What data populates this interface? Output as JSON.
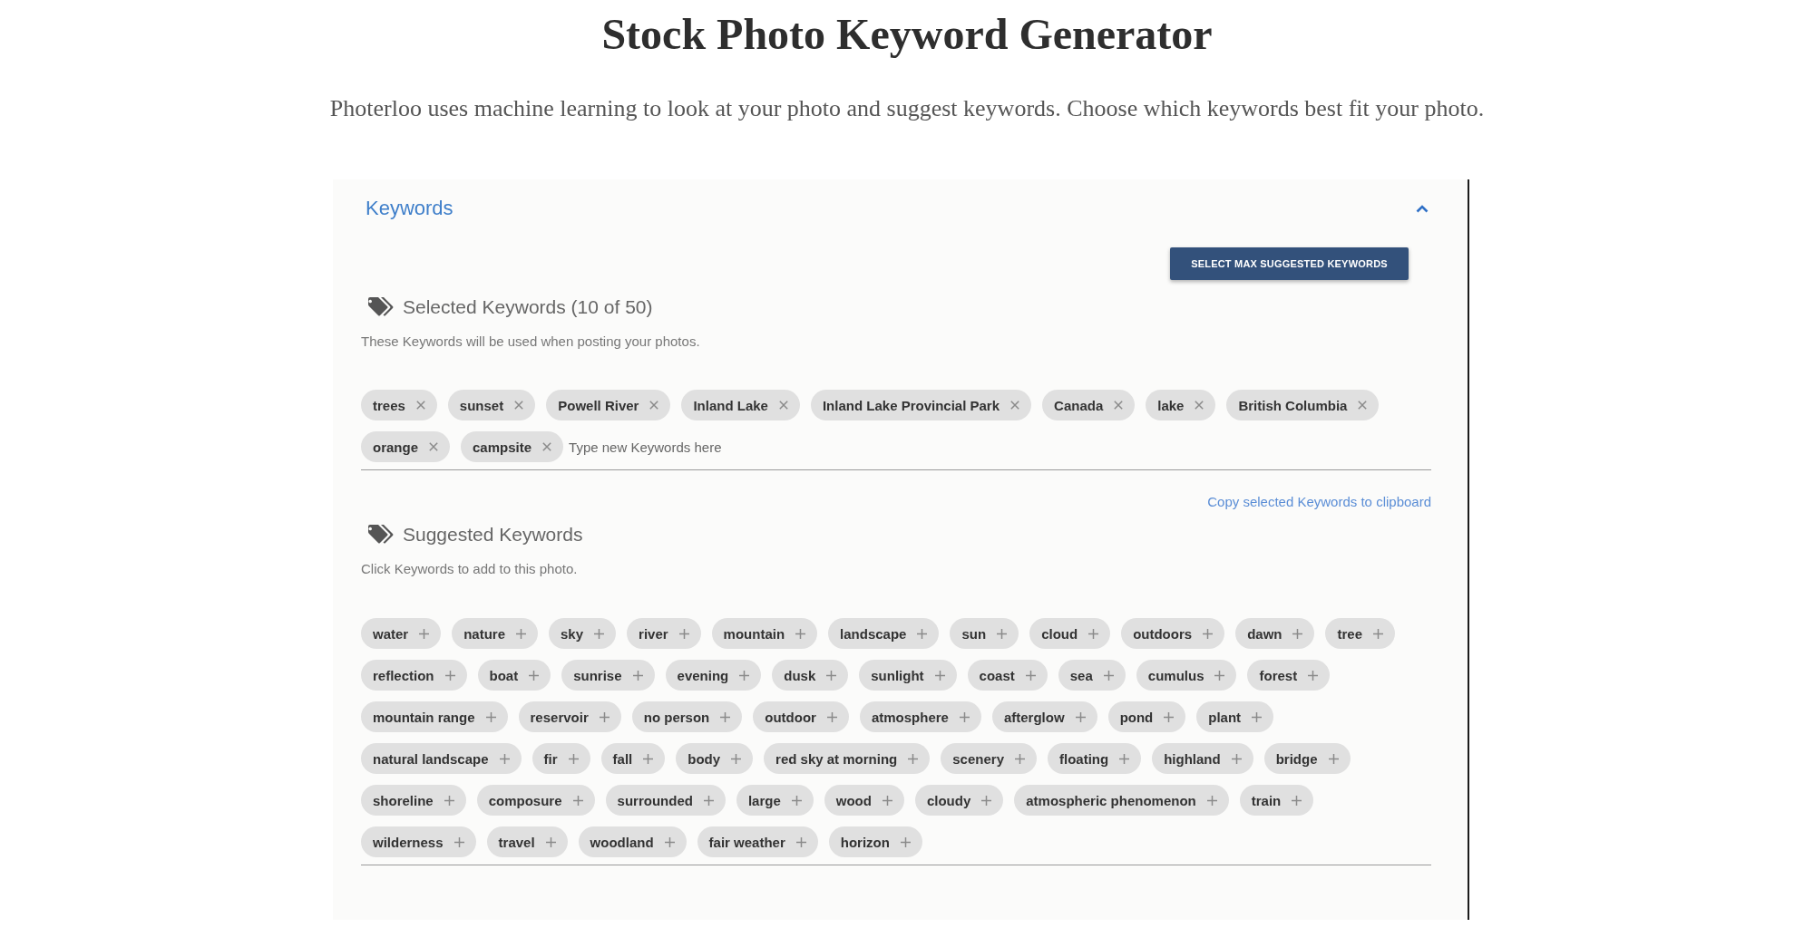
{
  "page": {
    "title": "Stock Photo Keyword Generator",
    "intro": "Photerloo uses machine learning to look at your photo and suggest keywords. Choose which keywords best fit your photo."
  },
  "panel": {
    "title": "Keywords",
    "expanded": true,
    "action_button": "SELECT MAX SUGGESTED KEYWORDS",
    "selected_section": {
      "heading": "Selected Keywords (10 of 50)",
      "hint": "These Keywords will be used when posting your photos.",
      "keywords": [
        "trees",
        "sunset",
        "Powell River",
        "Inland Lake",
        "Inland Lake Provincial Park",
        "Canada",
        "lake",
        "British Columbia",
        "orange",
        "campsite"
      ],
      "input": {
        "placeholder": "Type new Keywords here"
      },
      "copy_link": "Copy selected Keywords to clipboard"
    },
    "suggested_section": {
      "heading": "Suggested Keywords",
      "hint": "Click Keywords to add to this photo.",
      "keywords": [
        "water",
        "nature",
        "sky",
        "river",
        "mountain",
        "landscape",
        "sun",
        "cloud",
        "outdoors",
        "dawn",
        "tree",
        "reflection",
        "boat",
        "sunrise",
        "evening",
        "dusk",
        "sunlight",
        "coast",
        "sea",
        "cumulus",
        "forest",
        "mountain range",
        "reservoir",
        "no person",
        "outdoor",
        "atmosphere",
        "afterglow",
        "pond",
        "plant",
        "natural landscape",
        "fir",
        "fall",
        "body",
        "red sky at morning",
        "scenery",
        "floating",
        "highland",
        "bridge",
        "shoreline",
        "composure",
        "surrounded",
        "large",
        "wood",
        "cloudy",
        "atmospheric phenomenon",
        "train",
        "wilderness",
        "travel",
        "woodland",
        "fair weather",
        "horizon"
      ]
    }
  }
}
